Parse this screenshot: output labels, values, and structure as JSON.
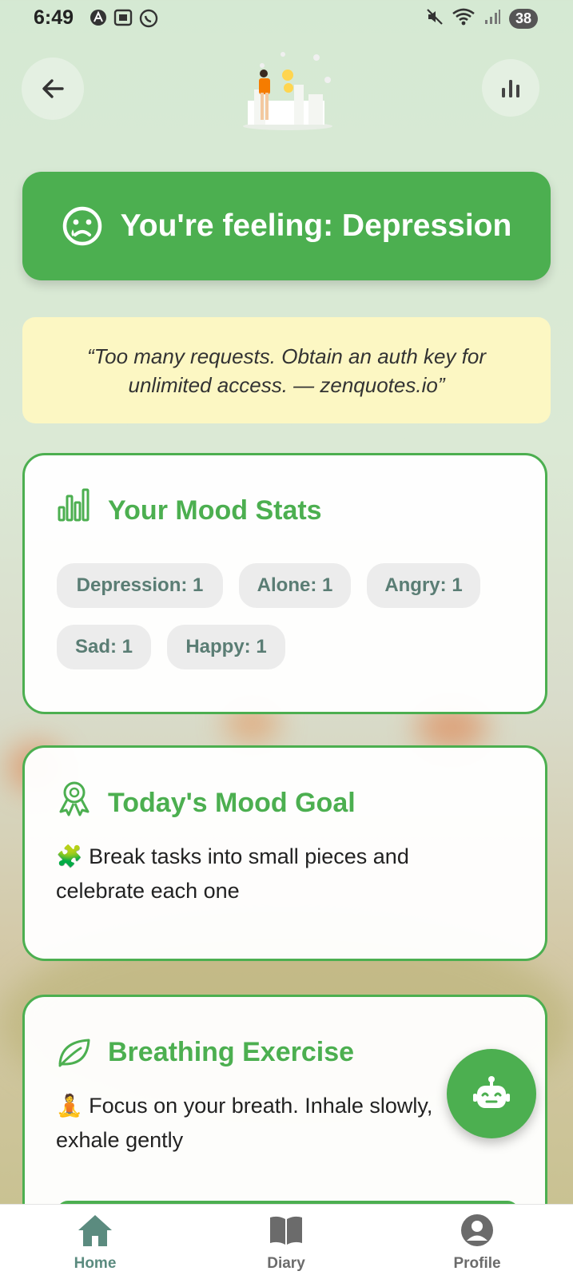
{
  "status_bar": {
    "time": "6:49",
    "battery": "38"
  },
  "header": {
    "back_icon": "arrow-left-icon",
    "stats_icon": "bar-chart-icon",
    "illustration": "person-with-emojis-illustration"
  },
  "feeling": {
    "text": "You're feeling: Depression",
    "icon": "sad-face-icon"
  },
  "quote": {
    "text": "“Too many requests. Obtain an auth key for unlimited access. — zenquotes.io”"
  },
  "mood_stats": {
    "title": "Your Mood Stats",
    "chips": [
      {
        "label": "Depression: 1"
      },
      {
        "label": "Alone: 1"
      },
      {
        "label": "Angry: 1"
      },
      {
        "label": "Sad: 1"
      },
      {
        "label": "Happy: 1"
      }
    ]
  },
  "mood_goal": {
    "title": "Today's Mood Goal",
    "emoji": "🧩",
    "text": "Break tasks into small pieces and celebrate each one"
  },
  "breathing": {
    "title": "Breathing Exercise",
    "emoji": "🧘",
    "text": "Focus on your breath. Inhale slowly, exhale gently"
  },
  "fab": {
    "icon": "robot-icon"
  },
  "bottom_nav": {
    "items": [
      {
        "label": "Home",
        "icon": "home-icon"
      },
      {
        "label": "Diary",
        "icon": "book-icon"
      },
      {
        "label": "Profile",
        "icon": "profile-icon"
      }
    ]
  },
  "colors": {
    "accent": "#4caf50",
    "quote_bg": "#fcf7c3",
    "chip_text": "#5a7d74",
    "nav_active": "#5b8b7f",
    "nav_inactive": "#6b6b6b"
  }
}
